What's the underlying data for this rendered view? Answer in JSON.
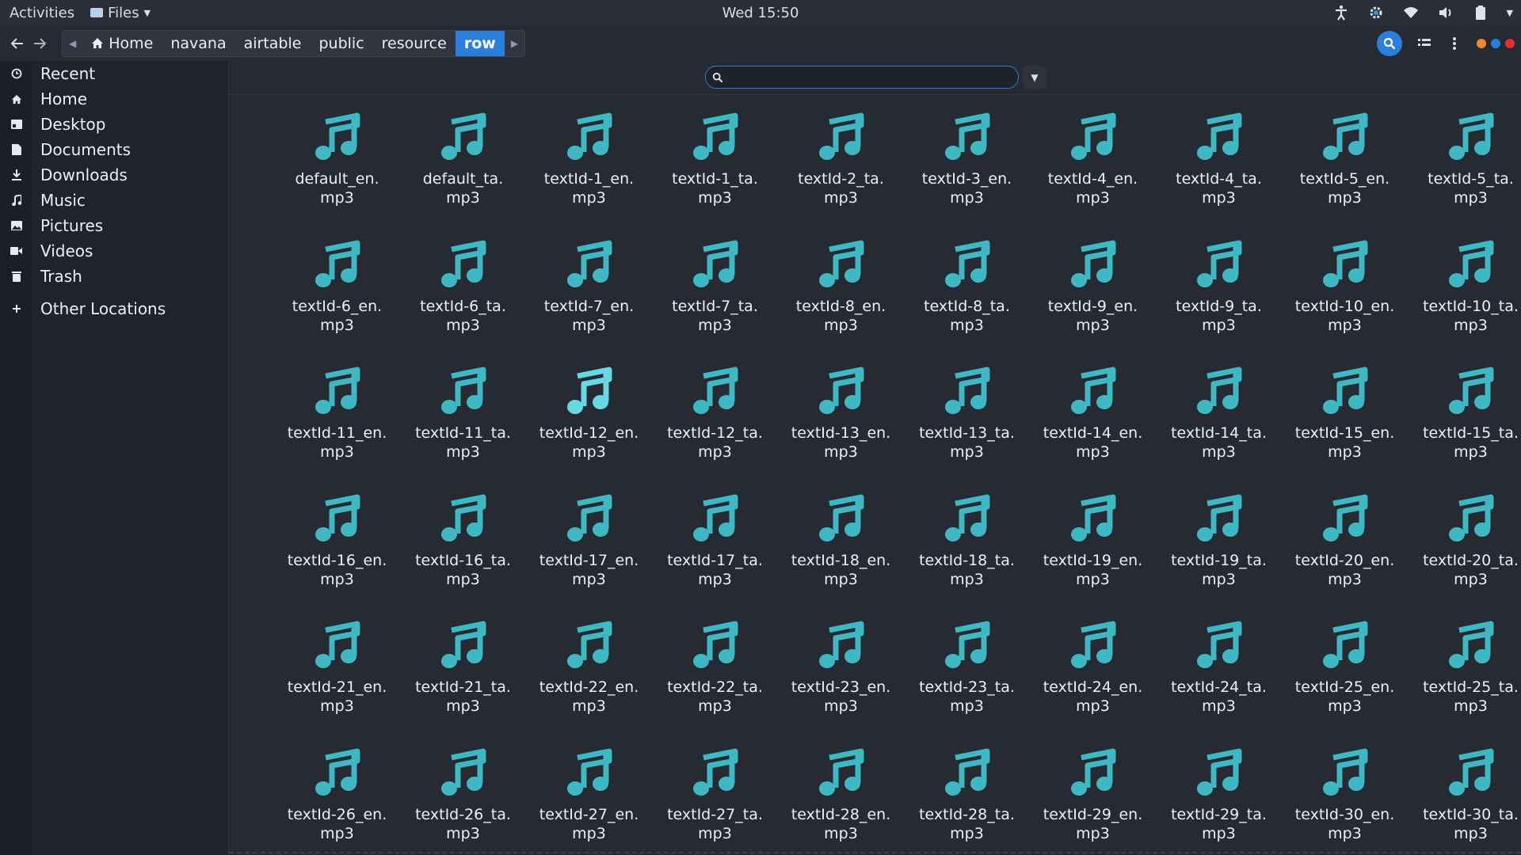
{
  "topbar": {
    "activities": "Activities",
    "app_name": "Files",
    "clock": "Wed 15:50"
  },
  "header": {
    "breadcrumbs": [
      "Home",
      "navana",
      "airtable",
      "public",
      "resource",
      "row"
    ],
    "active_crumb": "row"
  },
  "sidebar": {
    "items": [
      {
        "label": "Recent",
        "icon": "clock-icon"
      },
      {
        "label": "Home",
        "icon": "home-icon"
      },
      {
        "label": "Desktop",
        "icon": "desktop-icon"
      },
      {
        "label": "Documents",
        "icon": "document-icon"
      },
      {
        "label": "Downloads",
        "icon": "download-icon"
      },
      {
        "label": "Music",
        "icon": "music-icon"
      },
      {
        "label": "Pictures",
        "icon": "picture-icon"
      },
      {
        "label": "Videos",
        "icon": "video-icon"
      },
      {
        "label": "Trash",
        "icon": "trash-icon"
      }
    ],
    "other_locations": "Other Locations"
  },
  "search": {
    "value": ""
  },
  "files": [
    {
      "line1": "default_en.",
      "line2": "mp3"
    },
    {
      "line1": "default_ta.",
      "line2": "mp3"
    },
    {
      "line1": "textId-1_en.",
      "line2": "mp3"
    },
    {
      "line1": "textId-1_ta.",
      "line2": "mp3"
    },
    {
      "line1": "textId-2_ta.",
      "line2": "mp3"
    },
    {
      "line1": "textId-3_en.",
      "line2": "mp3"
    },
    {
      "line1": "textId-4_en.",
      "line2": "mp3"
    },
    {
      "line1": "textId-4_ta.",
      "line2": "mp3"
    },
    {
      "line1": "textId-5_en.",
      "line2": "mp3"
    },
    {
      "line1": "textId-5_ta.",
      "line2": "mp3"
    },
    {
      "line1": "textId-6_en.",
      "line2": "mp3"
    },
    {
      "line1": "textId-6_ta.",
      "line2": "mp3"
    },
    {
      "line1": "textId-7_en.",
      "line2": "mp3"
    },
    {
      "line1": "textId-7_ta.",
      "line2": "mp3"
    },
    {
      "line1": "textId-8_en.",
      "line2": "mp3"
    },
    {
      "line1": "textId-8_ta.",
      "line2": "mp3"
    },
    {
      "line1": "textId-9_en.",
      "line2": "mp3"
    },
    {
      "line1": "textId-9_ta.",
      "line2": "mp3"
    },
    {
      "line1": "textId-10_en.",
      "line2": "mp3"
    },
    {
      "line1": "textId-10_ta.",
      "line2": "mp3"
    },
    {
      "line1": "textId-11_en.",
      "line2": "mp3"
    },
    {
      "line1": "textId-11_ta.",
      "line2": "mp3"
    },
    {
      "line1": "textId-12_en.",
      "line2": "mp3",
      "hover": true
    },
    {
      "line1": "textId-12_ta.",
      "line2": "mp3"
    },
    {
      "line1": "textId-13_en.",
      "line2": "mp3"
    },
    {
      "line1": "textId-13_ta.",
      "line2": "mp3"
    },
    {
      "line1": "textId-14_en.",
      "line2": "mp3"
    },
    {
      "line1": "textId-14_ta.",
      "line2": "mp3"
    },
    {
      "line1": "textId-15_en.",
      "line2": "mp3"
    },
    {
      "line1": "textId-15_ta.",
      "line2": "mp3"
    },
    {
      "line1": "textId-16_en.",
      "line2": "mp3"
    },
    {
      "line1": "textId-16_ta.",
      "line2": "mp3"
    },
    {
      "line1": "textId-17_en.",
      "line2": "mp3"
    },
    {
      "line1": "textId-17_ta.",
      "line2": "mp3"
    },
    {
      "line1": "textId-18_en.",
      "line2": "mp3"
    },
    {
      "line1": "textId-18_ta.",
      "line2": "mp3"
    },
    {
      "line1": "textId-19_en.",
      "line2": "mp3"
    },
    {
      "line1": "textId-19_ta.",
      "line2": "mp3"
    },
    {
      "line1": "textId-20_en.",
      "line2": "mp3"
    },
    {
      "line1": "textId-20_ta.",
      "line2": "mp3"
    },
    {
      "line1": "textId-21_en.",
      "line2": "mp3"
    },
    {
      "line1": "textId-21_ta.",
      "line2": "mp3"
    },
    {
      "line1": "textId-22_en.",
      "line2": "mp3"
    },
    {
      "line1": "textId-22_ta.",
      "line2": "mp3"
    },
    {
      "line1": "textId-23_en.",
      "line2": "mp3"
    },
    {
      "line1": "textId-23_ta.",
      "line2": "mp3"
    },
    {
      "line1": "textId-24_en.",
      "line2": "mp3"
    },
    {
      "line1": "textId-24_ta.",
      "line2": "mp3"
    },
    {
      "line1": "textId-25_en.",
      "line2": "mp3"
    },
    {
      "line1": "textId-25_ta.",
      "line2": "mp3"
    },
    {
      "line1": "textId-26_en.",
      "line2": "mp3"
    },
    {
      "line1": "textId-26_ta.",
      "line2": "mp3"
    },
    {
      "line1": "textId-27_en.",
      "line2": "mp3"
    },
    {
      "line1": "textId-27_ta.",
      "line2": "mp3"
    },
    {
      "line1": "textId-28_en.",
      "line2": "mp3"
    },
    {
      "line1": "textId-28_ta.",
      "line2": "mp3"
    },
    {
      "line1": "textId-29_en.",
      "line2": "mp3"
    },
    {
      "line1": "textId-29_ta.",
      "line2": "mp3"
    },
    {
      "line1": "textId-30_en.",
      "line2": "mp3"
    },
    {
      "line1": "textId-30_ta.",
      "line2": "mp3"
    }
  ],
  "colors": {
    "accent": "#2a7fdc",
    "music_icon": "#3fb8c4",
    "music_icon_hover": "#67d8e4",
    "wm_dot_1": "#f0892b",
    "wm_dot_2": "#2a7fdc",
    "wm_dot_3": "#e0312e"
  }
}
